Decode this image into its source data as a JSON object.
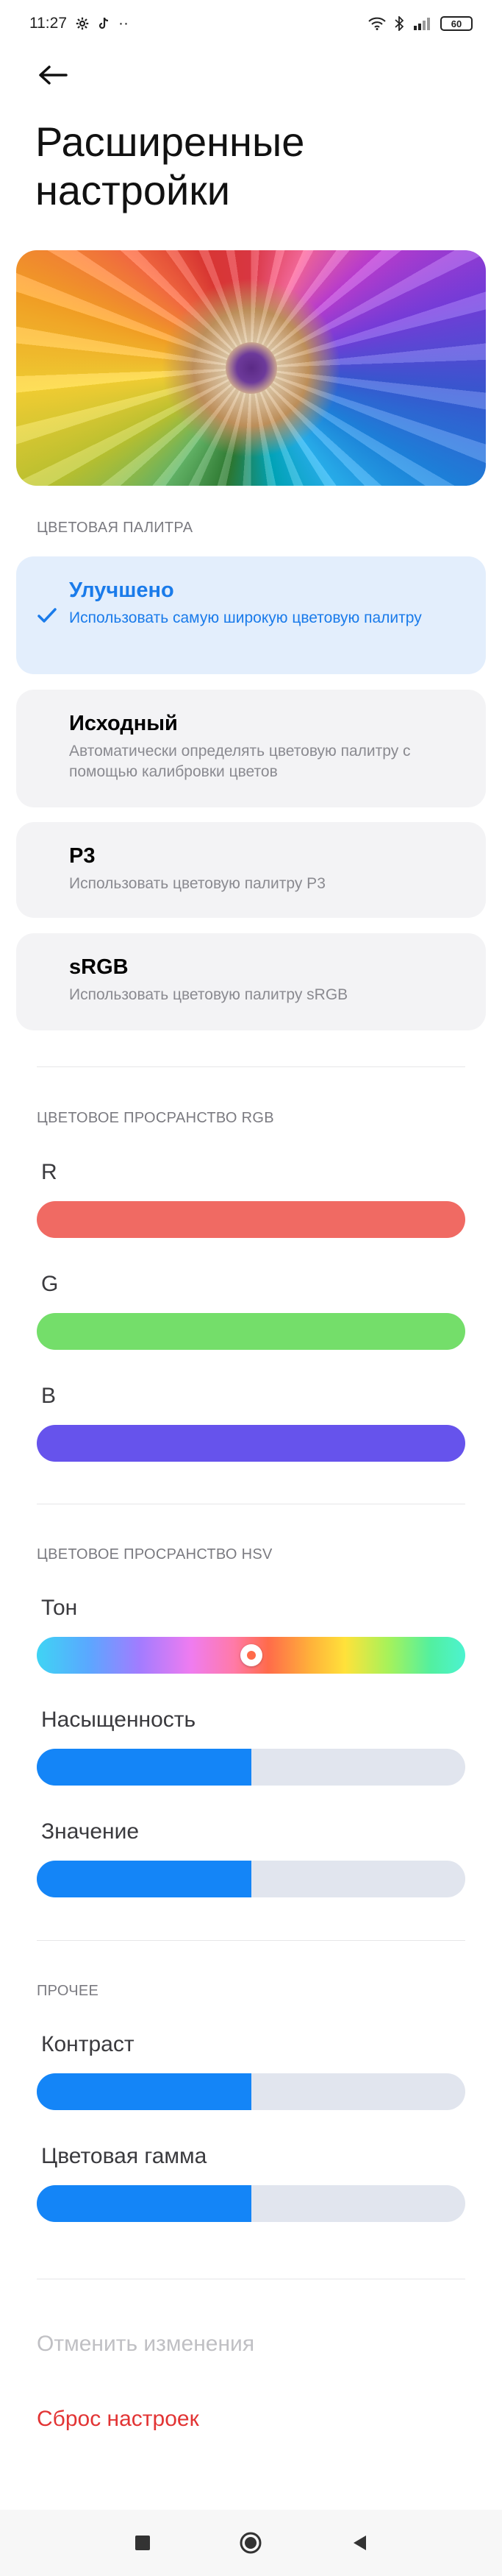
{
  "status_bar": {
    "time": "11:27",
    "dots": "··",
    "battery": "60"
  },
  "header": {
    "title": "Расширенные настройки"
  },
  "palette_section": {
    "label": "ЦВЕТОВАЯ ПАЛИТРА",
    "options": [
      {
        "title": "Улучшено",
        "desc": "Использовать самую широкую цветовую палитру",
        "selected": true
      },
      {
        "title": "Исходный",
        "desc": "Автоматически определять цветовую палитру с помощью калибровки цветов",
        "selected": false
      },
      {
        "title": "P3",
        "desc": "Использовать цветовую палитру P3",
        "selected": false
      },
      {
        "title": "sRGB",
        "desc": "Использовать цветовую палитру sRGB",
        "selected": false
      }
    ]
  },
  "rgb_section": {
    "label": "ЦВЕТОВОЕ ПРОСРАНСТВО RGB",
    "r_label": "R",
    "r_color": "#f06a63",
    "g_label": "G",
    "g_color": "#74de6a",
    "b_label": "B",
    "b_color": "#6653ec"
  },
  "hsv_section": {
    "label": "ЦВЕТОВОЕ ПРОСРАНСТВО HSV",
    "hue_label": "Тон",
    "hue_value": 0.5,
    "saturation_label": "Насыщенность",
    "saturation_value": 0.5,
    "value_label": "Значение",
    "value_value": 0.5
  },
  "other_section": {
    "label": "ПРОЧЕЕ",
    "contrast_label": "Контраст",
    "contrast_value": 0.5,
    "gamut_label": "Цветовая гамма",
    "gamut_value": 0.5
  },
  "actions": {
    "cancel": "Отменить изменения",
    "reset": "Сброс настроек"
  },
  "colors": {
    "accent": "#1485f7",
    "danger": "#e23434",
    "selected_bg": "#e3eefc"
  }
}
